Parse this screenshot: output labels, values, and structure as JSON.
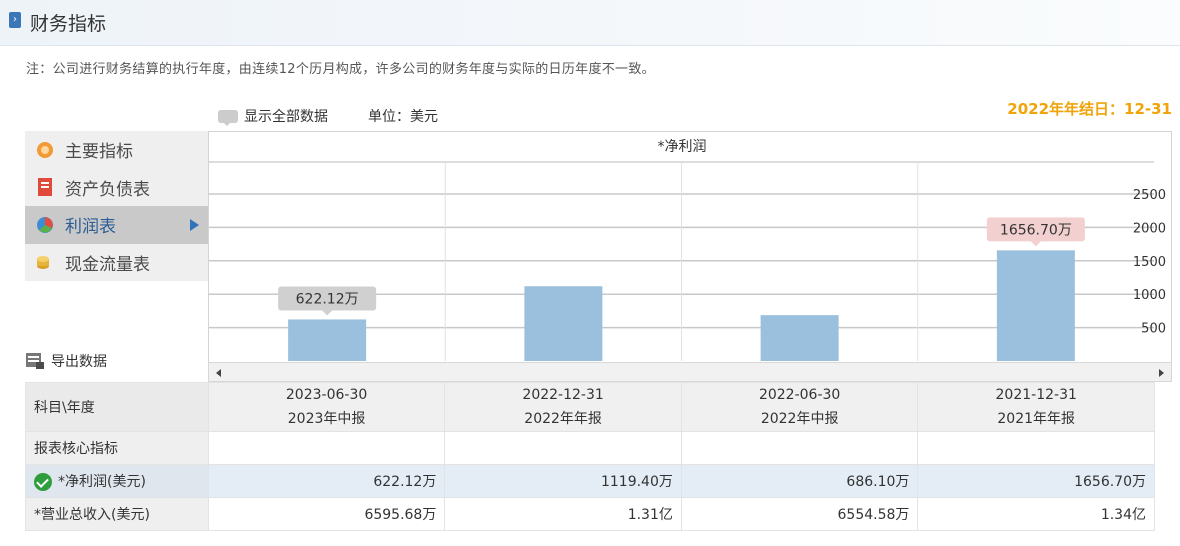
{
  "header": {
    "title": "财务指标",
    "chevron_icon": "chevron-right-icon"
  },
  "note": "注：公司进行财务结算的执行年度，由连续12个历月构成，许多公司的财务年度与实际的日历年度不一致。",
  "controls": {
    "show_all_label": "显示全部数据",
    "unit_label": "单位：美元",
    "year_end": "2022年年结日：12-31"
  },
  "menu": [
    {
      "label": "主要指标",
      "icon": "gear-flower-icon",
      "active": false
    },
    {
      "label": "资产负债表",
      "icon": "document-icon",
      "active": false
    },
    {
      "label": "利润表",
      "icon": "pie-chart-icon",
      "active": true
    },
    {
      "label": "现金流量表",
      "icon": "coins-icon",
      "active": false
    }
  ],
  "export_label": "导出数据",
  "chart_data": {
    "type": "bar",
    "title": "*净利润",
    "categories": [
      "2023-06-30",
      "2022-12-31",
      "2022-06-30",
      "2021-12-31"
    ],
    "values": [
      622.12,
      1119.4,
      686.1,
      1656.7
    ],
    "yticks": [
      "500",
      "1000",
      "1500",
      "2000",
      "2500"
    ],
    "ylim": [
      0,
      2500
    ],
    "data_labels": [
      "622.12万",
      "",
      "",
      "1656.70万"
    ],
    "bar_color": "#9ac0dd",
    "grid": true
  },
  "table": {
    "header_label": "科目\\年度",
    "columns": [
      {
        "date": "2023-06-30",
        "report": "2023年中报"
      },
      {
        "date": "2022-12-31",
        "report": "2022年年报"
      },
      {
        "date": "2022-06-30",
        "report": "2022年中报"
      },
      {
        "date": "2021-12-31",
        "report": "2021年年报"
      }
    ],
    "section_label": "报表核心指标",
    "rows": [
      {
        "label": "*净利润(美元)",
        "values": [
          "622.12万",
          "1119.40万",
          "686.10万",
          "1656.70万"
        ]
      },
      {
        "label": "*营业总收入(美元)",
        "values": [
          "6595.68万",
          "1.31亿",
          "6554.58万",
          "1.34亿"
        ]
      }
    ]
  }
}
